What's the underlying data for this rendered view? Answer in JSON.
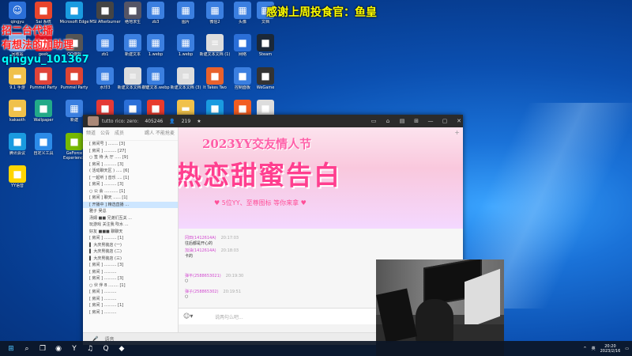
{
  "colors": {
    "accent": "#1a72d8",
    "overlay_red": "#ff2020",
    "overlay_yellow": "#ffff00",
    "overlay_cyan": "#00ffff",
    "banner_pink": "#ff3f8f"
  },
  "overlay": {
    "top": "感谢上周投食官：鱼皇",
    "left_line1": "招二台代播",
    "left_line2": "有想法的加助理",
    "left_line3": "qingyu_101367"
  },
  "desktop_icons": [
    {
      "label": "qingyu",
      "icon": "user-icon",
      "color": "#2b6fd8"
    },
    {
      "label": "Sai 系统",
      "icon": "app-icon",
      "color": "#e8452c"
    },
    {
      "label": "Microsoft Edge",
      "icon": "edge-icon",
      "color": "#1a9be0"
    },
    {
      "label": "MSI Afterburner",
      "icon": "msi-icon",
      "color": "#444"
    },
    {
      "label": "绝地求生",
      "icon": "game-icon",
      "color": "#556"
    },
    {
      "label": "zb3",
      "icon": "image-file-icon",
      "color": "#3b7fe0"
    },
    {
      "label": "图片",
      "icon": "image-file-icon",
      "color": "#3b7fe0"
    },
    {
      "label": "微信2",
      "icon": "image-file-icon",
      "color": "#3b7fe0"
    },
    {
      "label": "头像",
      "icon": "image-file-icon",
      "color": "#3b7fe0"
    },
    {
      "label": "文档",
      "icon": "image-file-icon",
      "color": "#3b7fe0"
    },
    {
      "label": "回收站",
      "icon": "recycle-bin-icon",
      "color": "#7fb0e8"
    },
    {
      "label": "geek",
      "icon": "geek-icon",
      "color": "#d12"
    },
    {
      "label": "QQ游戏",
      "icon": "qq-game-icon",
      "color": "#555"
    },
    {
      "label": "zb1",
      "icon": "image-file-icon",
      "color": "#3b7fe0"
    },
    {
      "label": "新建文本",
      "icon": "image-file-icon",
      "color": "#3b7fe0"
    },
    {
      "label": "1.webp",
      "icon": "image-file-icon",
      "color": "#3b7fe0"
    },
    {
      "label": "1.webp",
      "icon": "image-file-icon",
      "color": "#3b7fe0"
    },
    {
      "label": "新建文本文档 (1)",
      "icon": "text-file-icon",
      "color": "#ddd"
    },
    {
      "label": "网络",
      "icon": "network-icon",
      "color": "#2b6fd8"
    },
    {
      "label": "Steam",
      "icon": "steam-icon",
      "color": "#1b2838"
    },
    {
      "label": "9.1 手游",
      "icon": "folder-icon",
      "color": "#f0c14b"
    },
    {
      "label": "Pummel Party",
      "icon": "pummel-icon",
      "color": "#e0443a"
    },
    {
      "label": "Pummel Party",
      "icon": "pummel-icon",
      "color": "#d43"
    },
    {
      "label": "水印3",
      "icon": "image-file-icon",
      "color": "#3b7fe0"
    },
    {
      "label": "新建文本文档 (7)",
      "icon": "text-file-icon",
      "color": "#ddd"
    },
    {
      "label": "新建文本.webp",
      "icon": "image-file-icon",
      "color": "#3b7fe0"
    },
    {
      "label": "新建文本文档 (3)",
      "icon": "text-file-icon",
      "color": "#ddd"
    },
    {
      "label": "It Takes Two",
      "icon": "game-icon",
      "color": "#e8612c"
    },
    {
      "label": "控制面板",
      "icon": "control-panel-icon",
      "color": "#3b7fe0"
    },
    {
      "label": "WeGame",
      "icon": "wegame-icon",
      "color": "#333"
    },
    {
      "label": "kakaoth",
      "icon": "folder-icon",
      "color": "#f0c14b"
    },
    {
      "label": "Wallpaper",
      "icon": "wallpaper-icon",
      "color": "#2a8"
    },
    {
      "label": "新建",
      "icon": "image-file-icon",
      "color": "#3b7fe0"
    },
    {
      "label": "EA",
      "icon": "ea-icon",
      "color": "#e53935"
    },
    {
      "label": "在线观看",
      "icon": "monitor-icon",
      "color": "#2b6fd8"
    },
    {
      "label": "快乐游戏",
      "icon": "game-icon",
      "color": "#e83a2c"
    },
    {
      "label": "BDM",
      "icon": "folder-icon",
      "color": "#f0c14b"
    },
    {
      "label": "连接中心",
      "icon": "app-icon",
      "color": "#1a9be0"
    },
    {
      "label": "快手直播",
      "icon": "play-icon",
      "color": "#f25d22"
    },
    {
      "label": "桌面",
      "icon": "file-icon",
      "color": "#ddd"
    },
    {
      "label": "腾讯会议",
      "icon": "meeting-icon",
      "color": "#1a9be0"
    },
    {
      "label": "自定义工具",
      "icon": "app-icon",
      "color": "#2c8be8"
    },
    {
      "label": "GeForce Experience",
      "icon": "nvidia-icon",
      "color": "#76b900"
    },
    {
      "label": "网易云音乐",
      "icon": "music-icon",
      "color": "#e02020"
    },
    {
      "label": "Studio One",
      "icon": "studio-icon",
      "color": "#111"
    },
    {
      "label": "OBS Studio",
      "icon": "obs-icon",
      "color": "#222"
    },
    {
      "label": "QQ音乐",
      "icon": "qq-music-icon",
      "color": "#2aae67"
    },
    {
      "label": "QQ",
      "icon": "qq-icon",
      "color": "#1aa3ee"
    },
    {
      "label": "YY语音",
      "icon": "yy-icon",
      "color": "#ffd500"
    },
    {
      "label": "Google Chrome",
      "icon": "chrome-icon",
      "color": "#db4437"
    },
    {
      "label": "YY语音",
      "icon": "yy-icon",
      "color": "#ffd500"
    }
  ],
  "yy": {
    "room_name": "tutto rico: zero:",
    "room_id": "405246",
    "online_count": "219",
    "left_tabs": [
      "频道",
      "公告",
      "成员"
    ],
    "mode_label": "踢人 不能抢麦",
    "channel_rows": [
      "[ 房间号 ] ........ [3]",
      "[ 房间 ] .......... [27]",
      "○ 签 待 大 厅 ..... [9]",
      "[ 房间 ] .......... [3]",
      "( 活动聊天区 ) ..... [6]",
      "[ 一起听 ] 音乐 .... [1]",
      "[ 房间 ] .......... [3]",
      "○ 公 会 ........... [1]",
      "[ 房间 ] 聊天 ...... [1]",
      "[ 开播中 ] 精选直播 ...",
      "雅子 吴总",
      "汤姆 ■■ 兄弟们互关 ...",
      "玩游戏 关注我 吹水 ...",
      "好友 ■■■ 聊聊天",
      "[ 房间 ] .......... [1]",
      "▌ 大庆男装店 (一)",
      "▌ 大庆男装店 (二)",
      "▌ 大庆男装店 (三)",
      "[ 房间 ] .......... [3]",
      "[ 房间 ] ..........",
      "[ 房间 ] .......... [3]",
      "○ 伙 伴 B ........ [1]",
      "[ 房间 ] ..........",
      "[ 房间 ] ..........",
      "[ 房间 ] .......... [1]",
      "[ 房间 ] .........."
    ],
    "banner_title": "2023YY交友情人节",
    "banner_main": "热恋甜蜜告白",
    "banner_sub": "♥ 5位YY、至尊图标  等你来拿 ♥",
    "messages": [
      {
        "who": "冈田(1412614A)",
        "time": "20:17:03",
        "text": "往后都是开心的"
      },
      {
        "who": "加油(1412614A)",
        "time": "20:18:03",
        "text": "卡的"
      },
      {
        "who": "弹平(2588653021)",
        "time": "20:19:30",
        "text": "○"
      },
      {
        "who": "弹子(258865302)",
        "time": "20:19:51",
        "text": "○"
      }
    ],
    "input_placeholder": "说两句么吧...",
    "bottom_tools": [
      "语音",
      "点歌",
      "♪"
    ]
  },
  "taskbar": {
    "items": [
      "start-icon",
      "search-icon",
      "taskview-icon",
      "browser-icon",
      "yy-icon",
      "music-icon",
      "qq-icon",
      "game-icon"
    ],
    "clock_time": "20:20",
    "clock_date": "2023/2/16",
    "lang": "英"
  }
}
